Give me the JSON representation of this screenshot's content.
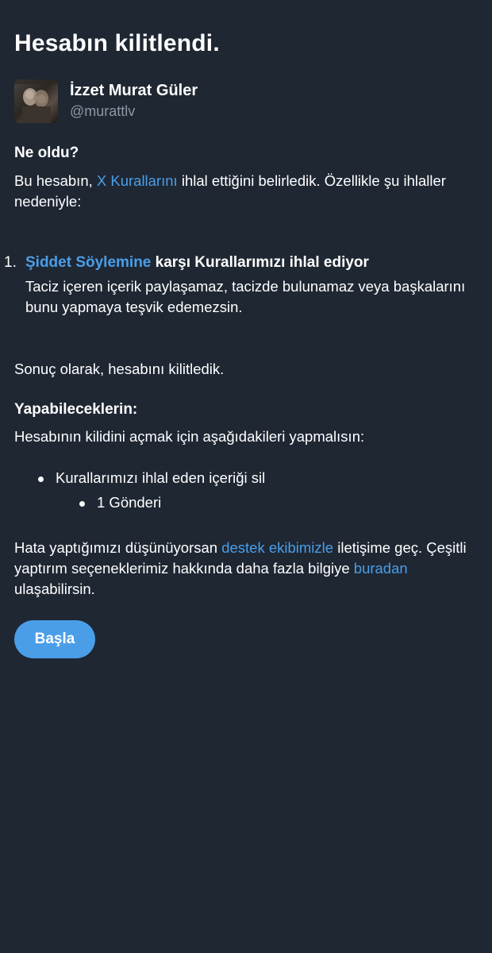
{
  "page": {
    "title": "Hesabın kilitlendi."
  },
  "profile": {
    "display_name": "İzzet Murat Güler",
    "handle": "@murattlv"
  },
  "what_happened": {
    "heading": "Ne oldu?",
    "text_before_link": "Bu hesabın, ",
    "rules_link": "X Kurallarını",
    "text_after_link": " ihlal ettiğini belirledik. Özellikle şu ihlaller nedeniyle:"
  },
  "violations": [
    {
      "number": "1.",
      "link": "Şiddet Söylemine",
      "title_rest": " karşı Kurallarımızı ihlal ediyor",
      "description": "Taciz içeren içerik paylaşamaz, tacizde bulunamaz veya başkalarını bunu yapmaya teşvik edemezsin."
    }
  ],
  "result_text": "Sonuç olarak, hesabını kilitledik.",
  "what_you_can_do": {
    "heading": "Yapabileceklerin:",
    "text": "Hesabının kilidini açmak için aşağıdakileri yapmalısın:",
    "steps": [
      {
        "label": "Kurallarımızı ihlal eden içeriği sil",
        "sub_items": [
          "1 Gönderi"
        ]
      }
    ]
  },
  "support": {
    "text_1": "Hata yaptığımızı düşünüyorsan ",
    "support_link": "destek ekibimizle",
    "text_2": " iletişime geç. Çeşitli yaptırım seçeneklerimiz hakkında daha fazla bilgiye ",
    "here_link": "buradan",
    "text_3": " ulaşabilirsin."
  },
  "start_button": "Başla",
  "colors": {
    "background": "#1f2733",
    "accent": "#4a9ee8",
    "text": "#ffffff",
    "muted": "#8b98a5"
  }
}
